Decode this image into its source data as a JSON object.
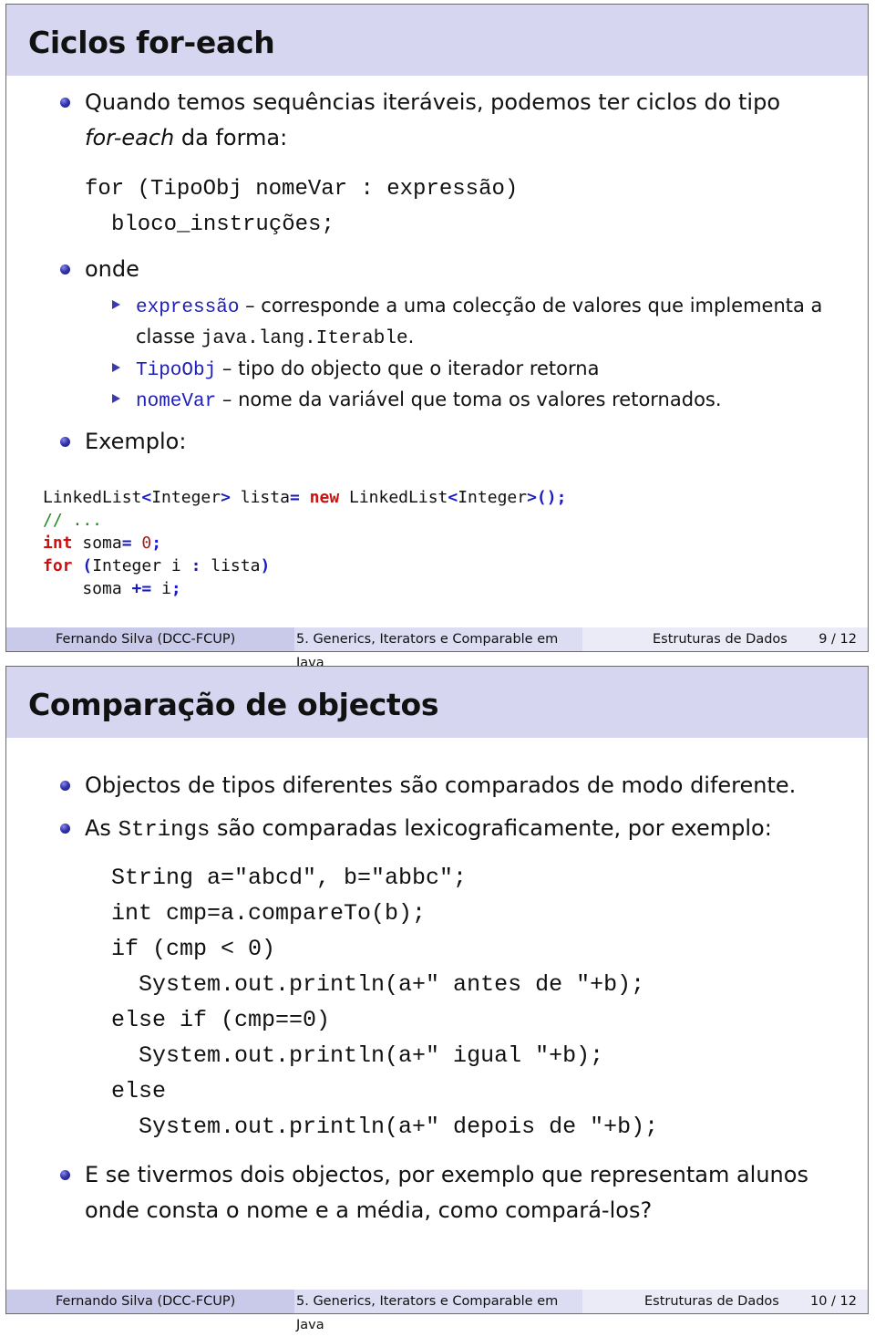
{
  "slides": [
    {
      "title": "Ciclos for-each",
      "bullet1": {
        "line1": "Quando temos sequências iteráveis, podemos ter ciclos do tipo",
        "line2_italic": "for-each",
        "line2_rest": " da forma:"
      },
      "syntax": {
        "line1": "for (TipoObj nomeVar : expressão)",
        "line2": "bloco_instruções;"
      },
      "bullet2": "onde",
      "sub_items": [
        {
          "term": "expressão",
          "dash": " – ",
          "text": "corresponde a uma colecção de valores que implementa a",
          "text2_prefix": "classe ",
          "text2_code": "java.lang.Iterable",
          "text2_suffix": "."
        },
        {
          "term": "TipoObj",
          "dash": " – ",
          "text": "tipo do objecto que o iterador retorna"
        },
        {
          "term": "nomeVar",
          "dash": " – ",
          "text": "nome da variável que toma os valores retornados."
        }
      ],
      "bullet3": "Exemplo:",
      "example_code": {
        "l1_a": "LinkedList",
        "l1_b": "<",
        "l1_c": "Integer",
        "l1_d": ">",
        "l1_e": " lista",
        "l1_f": "=",
        "l1_g": " ",
        "l1_h": "new",
        "l1_i": " LinkedList",
        "l1_j": "<",
        "l1_k": "Integer",
        "l1_l": ">",
        "l1_m": "();",
        "l2": "// ...",
        "l3_a": "int",
        "l3_b": " soma",
        "l3_c": "=",
        "l3_d": " ",
        "l3_e": "0",
        "l3_f": ";",
        "l4_a": "for",
        "l4_b": " (",
        "l4_c": "Integer i ",
        "l4_d": ":",
        "l4_e": " lista",
        "l4_f": ")",
        "l5_a": "    soma ",
        "l5_b": "+=",
        "l5_c": " i",
        "l5_d": ";"
      },
      "footer": {
        "author": "Fernando Silva  (DCC-FCUP)",
        "topic": "5. Generics, Iterators e Comparable em Java",
        "course": "Estruturas de Dados",
        "page": "9 / 12"
      }
    },
    {
      "title": "Comparação de objectos",
      "bullet1": "Objectos de tipos diferentes são comparados de modo diferente.",
      "bullet2": {
        "prefix": "As ",
        "code": "Strings",
        "rest": " são comparadas lexicograficamente, por exemplo:"
      },
      "code_lines": [
        "String a=\"abcd\", b=\"abbc\";",
        "int cmp=a.compareTo(b);",
        "if (cmp < 0)",
        "  System.out.println(a+\" antes de \"+b);",
        "else if (cmp==0)",
        "  System.out.println(a+\" igual \"+b);",
        "else",
        "  System.out.println(a+\" depois de \"+b);"
      ],
      "bullet3": {
        "line1": "E se tivermos dois objectos, por exemplo que representam alunos",
        "line2": "onde consta o nome e a média, como compará-los?"
      },
      "footer": {
        "author": "Fernando Silva  (DCC-FCUP)",
        "topic": "5. Generics, Iterators e Comparable em Java",
        "course": "Estruturas de Dados",
        "page": "10 / 12"
      }
    }
  ]
}
